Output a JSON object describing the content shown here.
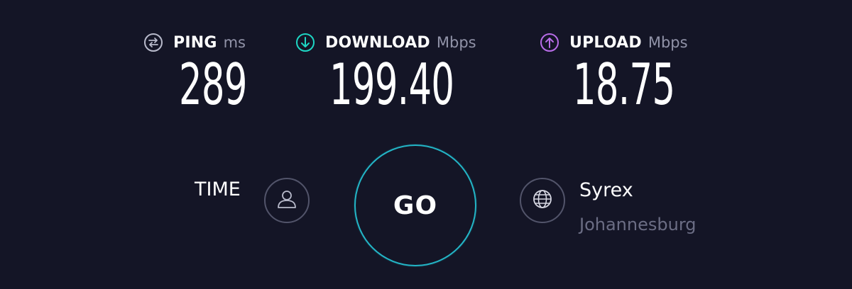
{
  "metrics": {
    "ping": {
      "title": "PING",
      "unit": "ms",
      "value": "289",
      "icon": "ping-icon",
      "color": "#b8bacb"
    },
    "download": {
      "title": "DOWNLOAD",
      "unit": "Mbps",
      "value": "199.40",
      "icon": "download-arrow-icon",
      "color": "#1ed6c4"
    },
    "upload": {
      "title": "UPLOAD",
      "unit": "Mbps",
      "value": "18.75",
      "icon": "upload-arrow-icon",
      "color": "#b86ce8"
    }
  },
  "time": {
    "label": "TIME",
    "icon": "user-icon"
  },
  "go": {
    "label": "GO",
    "color": "#23b5c6"
  },
  "server": {
    "name": "Syrex",
    "location": "Johannesburg",
    "icon": "globe-icon"
  },
  "theme": {
    "background": "#141526",
    "muted_text": "#9193a8",
    "ring": "#52546a"
  }
}
